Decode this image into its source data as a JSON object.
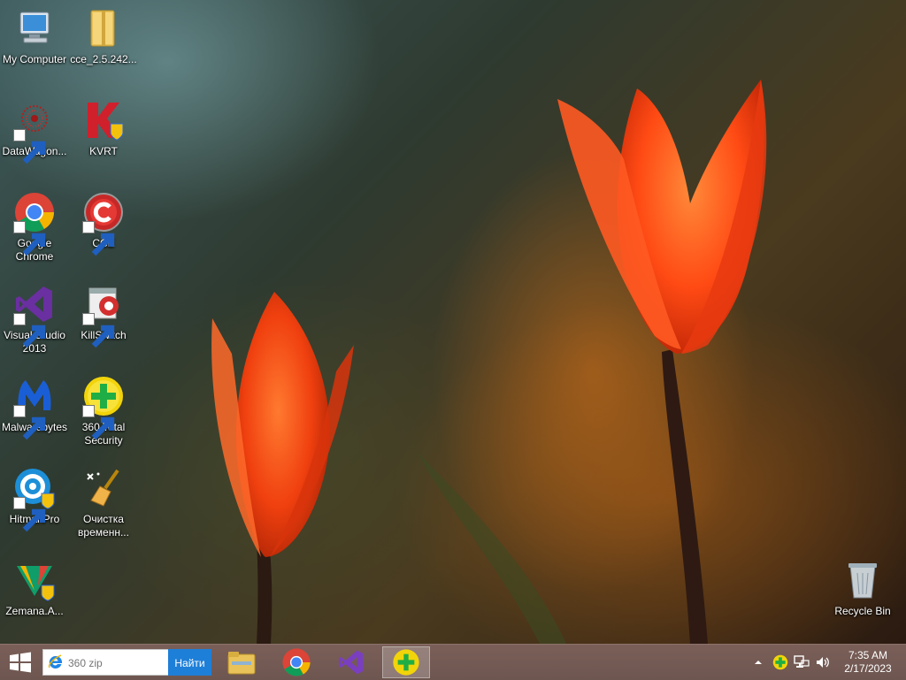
{
  "desktop": {
    "icons": [
      {
        "label": "My Computer"
      },
      {
        "label": "cce_2.5.242..."
      },
      {
        "label": "DataWagon..."
      },
      {
        "label": "KVRT"
      },
      {
        "label": "Google Chrome"
      },
      {
        "label": "CCE"
      },
      {
        "label": "Visual Studio 2013"
      },
      {
        "label": "KillSwitch"
      },
      {
        "label": "Malwarebytes"
      },
      {
        "label": "360 Total Security"
      },
      {
        "label": "HitmanPro"
      },
      {
        "label": "Очистка временн..."
      },
      {
        "label": "Zemana.A..."
      },
      {
        "label": "Recycle Bin"
      }
    ]
  },
  "taskbar": {
    "search": {
      "placeholder": "360 zip",
      "button_label": "Найти"
    },
    "pinned": [
      "file-explorer-icon",
      "chrome-icon",
      "visual-studio-icon",
      "360-total-security-icon"
    ],
    "active_app": "360-total-security-icon"
  },
  "tray": {
    "time": "7:35 AM",
    "date": "2/17/2023",
    "icons": [
      "show-hidden-icons-chevron",
      "360-tray-icon",
      "network-icon",
      "volume-icon"
    ]
  },
  "colors": {
    "taskbar": "#6e5650",
    "search_button": "#1e7fd8",
    "tulip": "#ff5a1c"
  }
}
